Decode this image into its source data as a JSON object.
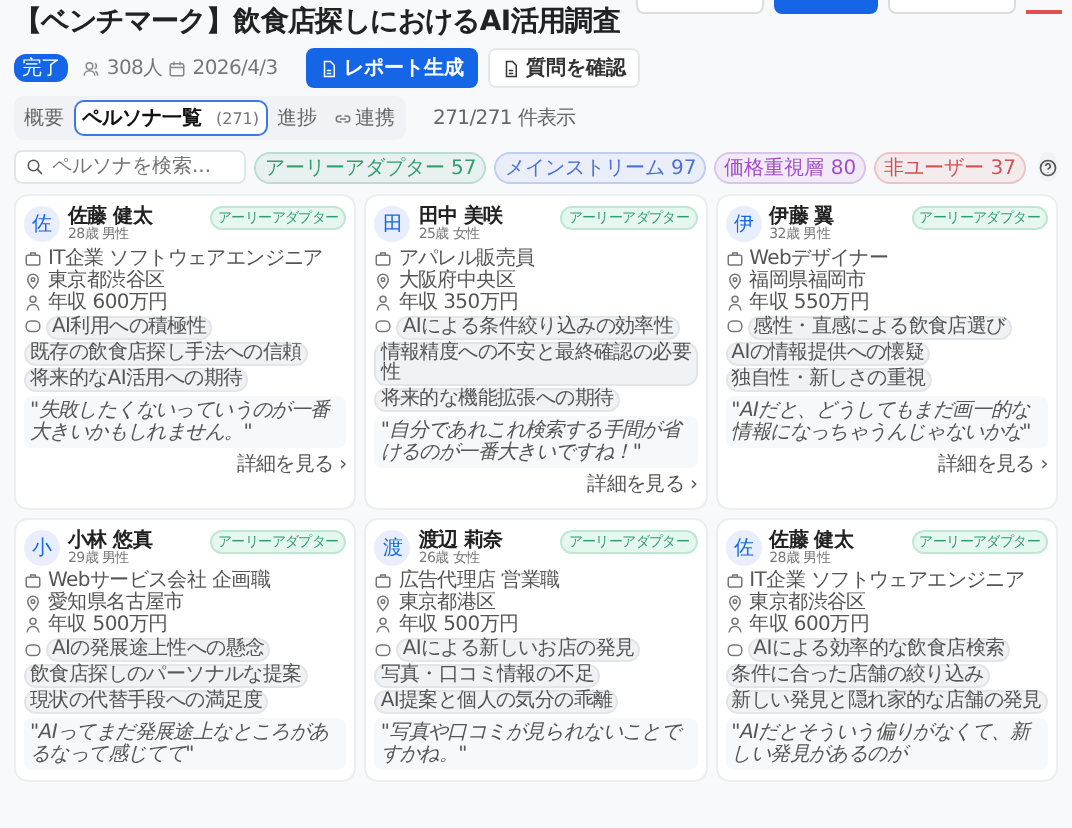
{
  "header_actions": [
    {
      "kind": "outline"
    },
    {
      "kind": "primary"
    },
    {
      "kind": "outline"
    },
    {
      "kind": "danger"
    }
  ],
  "title": "【ベンチマーク】飲食店探しにおけるAI活用調査",
  "status": "完了",
  "respondents": "308人",
  "date": "2026/4/3",
  "actions": [
    {
      "label": "レポート生成",
      "kind": "primary"
    },
    {
      "label": "質問を確認",
      "kind": "secondary"
    }
  ],
  "tabs": [
    {
      "label": "概要",
      "selected": false
    },
    {
      "label": "ペルソナ一覧",
      "count": "(271)",
      "selected": true
    },
    {
      "label": "進捗",
      "selected": false
    },
    {
      "label": "連携",
      "selected": false
    }
  ],
  "search": {
    "placeholder": "ペルソナを検索..."
  },
  "filters": [
    {
      "label": "アーリーアダプター",
      "count": "57",
      "color": "#2f9e6e"
    },
    {
      "label": "メインストリーム",
      "count": "97",
      "color": "#4a6fd6"
    },
    {
      "label": "価格重視層",
      "count": "80",
      "color": "#a24bc9"
    },
    {
      "label": "非ユーザー",
      "count": "37",
      "color": "#d05050"
    }
  ],
  "result_count": "271/271 件表示",
  "cards": [
    {
      "avatar": "佐",
      "name": "佐藤 健太",
      "meta": "28歳 男性",
      "segment": "アーリーアダプター",
      "job": "IT企業 ソフトウェアエンジニア",
      "location": "東京都渋谷区",
      "income": "年収 600万円",
      "tags": [
        "AI利用への積極性",
        "既存の飲食店探し手法への信頼",
        "将来的なAI活用への期待"
      ],
      "quote": "\"失敗したくないっていうのが一番大きいかもしれません。\"",
      "link": "詳細を見る ›"
    },
    {
      "avatar": "田",
      "name": "田中 美咲",
      "meta": "25歳 女性",
      "segment": "アーリーアダプター",
      "job": "アパレル販売員",
      "location": "大阪府中央区",
      "income": "年収 350万円",
      "tags": [
        "AIによる条件絞り込みの効率性",
        "情報精度への不安と最終確認の必要性",
        "将来的な機能拡張への期待"
      ],
      "quote": "\"自分であれこれ検索する手間が省けるのが一番大きいですね！\"",
      "link": "詳細を見る ›"
    },
    {
      "avatar": "伊",
      "name": "伊藤 翼",
      "meta": "32歳 男性",
      "segment": "アーリーアダプター",
      "job": "Webデザイナー",
      "location": "福岡県福岡市",
      "income": "年収 550万円",
      "tags": [
        "感性・直感による飲食店選び",
        "AIの情報提供への懐疑",
        "独自性・新しさの重視"
      ],
      "quote": "\"AIだと、どうしてもまだ画一的な情報になっちゃうんじゃないかな\"",
      "link": "詳細を見る ›"
    },
    {
      "avatar": "小",
      "name": "小林 悠真",
      "meta": "29歳 男性",
      "segment": "アーリーアダプター",
      "job": "Webサービス会社 企画職",
      "location": "愛知県名古屋市",
      "income": "年収 500万円",
      "tags": [
        "AIの発展途上性への懸念",
        "飲食店探しのパーソナルな提案",
        "現状の代替手段への満足度"
      ],
      "quote": "\"AIってまだ発展途上なところがあるなって感じてて\""
    },
    {
      "avatar": "渡",
      "name": "渡辺 莉奈",
      "meta": "26歳 女性",
      "segment": "アーリーアダプター",
      "job": "広告代理店 営業職",
      "location": "東京都港区",
      "income": "年収 500万円",
      "tags": [
        "AIによる新しいお店の発見",
        "写真・口コミ情報の不足",
        "AI提案と個人の気分の乖離"
      ],
      "quote": "\"写真や口コミが見られないことですかね。\""
    },
    {
      "avatar": "佐",
      "name": "佐藤 健太",
      "meta": "28歳 男性",
      "segment": "アーリーアダプター",
      "job": "IT企業 ソフトウェアエンジニア",
      "location": "東京都渋谷区",
      "income": "年収 600万円",
      "tags": [
        "AIによる効率的な飲食店検索",
        "条件に合った店舗の絞り込み",
        "新しい発見と隠れ家的な店舗の発見"
      ],
      "quote": "\"AIだとそういう偏りがなくて、新しい発見があるのが"
    }
  ]
}
